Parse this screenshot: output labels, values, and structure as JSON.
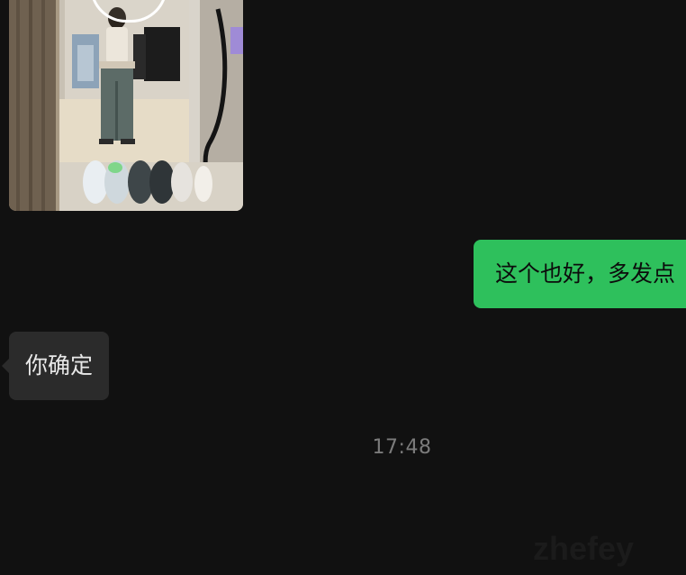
{
  "messages": {
    "video": {
      "type": "video",
      "icon": "play-icon"
    },
    "sent": {
      "text": "这个也好，多发点"
    },
    "received": {
      "text": "你确定"
    }
  },
  "timestamp": "17:48",
  "colors": {
    "background": "#111111",
    "sent_bubble": "#2ec05c",
    "received_bubble": "#2b2b2b",
    "timestamp_text": "#7b7b7b"
  },
  "watermark": "zhefey"
}
